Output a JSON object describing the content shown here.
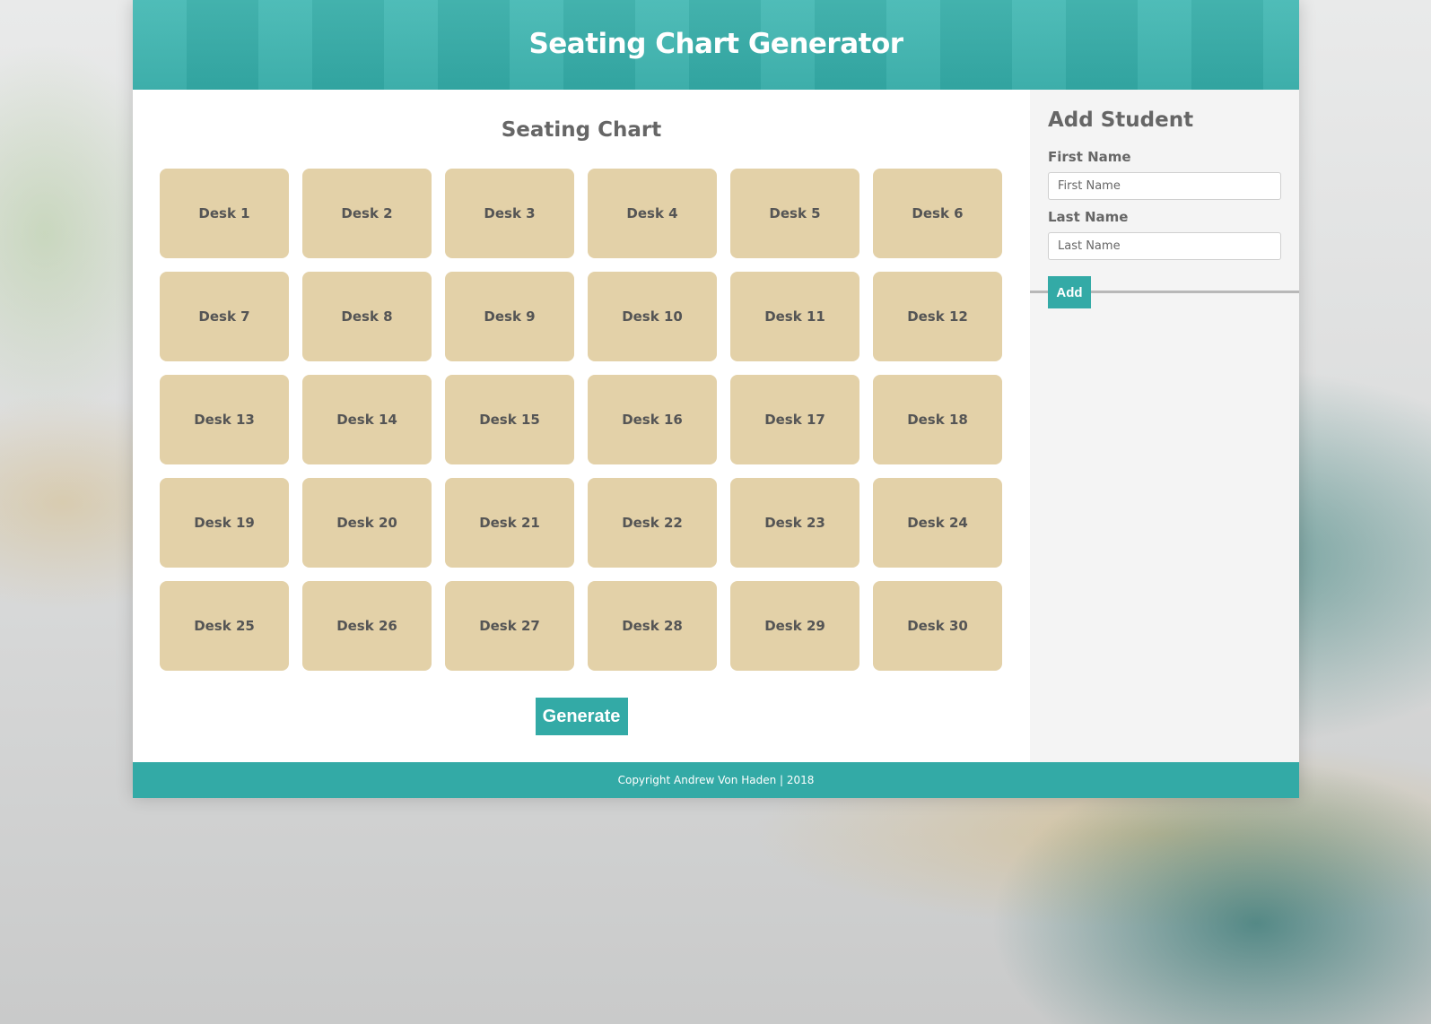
{
  "header": {
    "title": "Seating Chart Generator"
  },
  "main": {
    "title": "Seating Chart",
    "desks": [
      "Desk 1",
      "Desk 2",
      "Desk 3",
      "Desk 4",
      "Desk 5",
      "Desk 6",
      "Desk 7",
      "Desk 8",
      "Desk 9",
      "Desk 10",
      "Desk 11",
      "Desk 12",
      "Desk 13",
      "Desk 14",
      "Desk 15",
      "Desk 16",
      "Desk 17",
      "Desk 18",
      "Desk 19",
      "Desk 20",
      "Desk 21",
      "Desk 22",
      "Desk 23",
      "Desk 24",
      "Desk 25",
      "Desk 26",
      "Desk 27",
      "Desk 28",
      "Desk 29",
      "Desk 30"
    ],
    "generate_label": "Generate"
  },
  "sidebar": {
    "title": "Add Student",
    "first_name_label": "First Name",
    "first_name_placeholder": "First Name",
    "last_name_label": "Last Name",
    "last_name_placeholder": "Last Name",
    "add_label": "Add"
  },
  "footer": {
    "text": "Copyright Andrew Von Haden | 2018"
  },
  "colors": {
    "accent": "#33aaa6",
    "desk": "#e3d1a8",
    "text": "#666666"
  }
}
